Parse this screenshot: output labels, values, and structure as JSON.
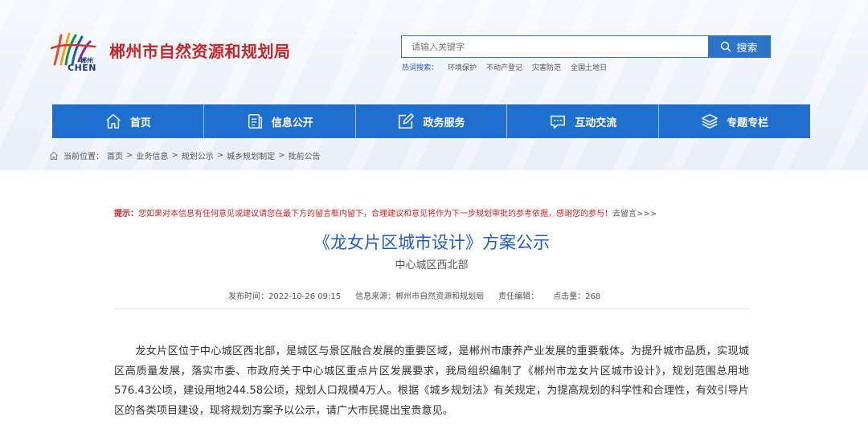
{
  "header": {
    "logo": {
      "cn": "郴州",
      "en": "CHEN"
    },
    "site_title": "郴州市自然资源和规划局",
    "search": {
      "placeholder": "请输入关键字",
      "button_label": "搜索"
    },
    "hot_search": {
      "label": "热词搜索：",
      "terms": [
        "环境保护",
        "不动产登记",
        "灾害防范",
        "全国土地日"
      ]
    }
  },
  "nav": {
    "items": [
      {
        "label": "首页",
        "icon": "home-icon"
      },
      {
        "label": "信息公开",
        "icon": "document-icon"
      },
      {
        "label": "政务服务",
        "icon": "edit-icon"
      },
      {
        "label": "互动交流",
        "icon": "chat-icon"
      },
      {
        "label": "专题专栏",
        "icon": "layers-icon"
      }
    ]
  },
  "breadcrumb": {
    "label": "当前位置：",
    "items": [
      "首页",
      "业务信息",
      "规划公示",
      "城乡规划制定",
      "批前公告"
    ],
    "separator": ">"
  },
  "article": {
    "tip": {
      "label": "提示：",
      "text": "您如果对本信息有任何意见或建议请您在最下方的留言框内留下，合理建议和意见将作为下一步规划审批的参考依据，感谢您的参与！",
      "link": "去留言>>>"
    },
    "title": "《龙女片区城市设计》方案公示",
    "subtitle": "中心城区西北部",
    "meta": {
      "publish_time": "发布时间：2022-10-26 09:15",
      "source": "信息来源：郴州市自然资源和规划局",
      "editor": "责任编辑：",
      "views": "点击量：268"
    },
    "body": "龙女片区位于中心城区西北部，是城区与景区融合发展的重要区域，是郴州市康养产业发展的重要载体。为提升城市品质，实现城区高质量发展，落实市委、市政府关于中心城区重点片区发展要求，我局组织编制了《郴州市龙女片区城市设计》，规划范围总用地576.43公顷，建设用地244.58公顷，规划人口规模4万人。根据《城乡规划法》有关规定，为提高规划的科学性和合理性，有效引导片区的各类项目建设，现将规划方案予以公示，请广大市民提出宝贵意见。"
  },
  "colors": {
    "brand_blue": "#1f6fcf",
    "title_red": "#c0282a",
    "link_blue": "#1f5fb8"
  }
}
